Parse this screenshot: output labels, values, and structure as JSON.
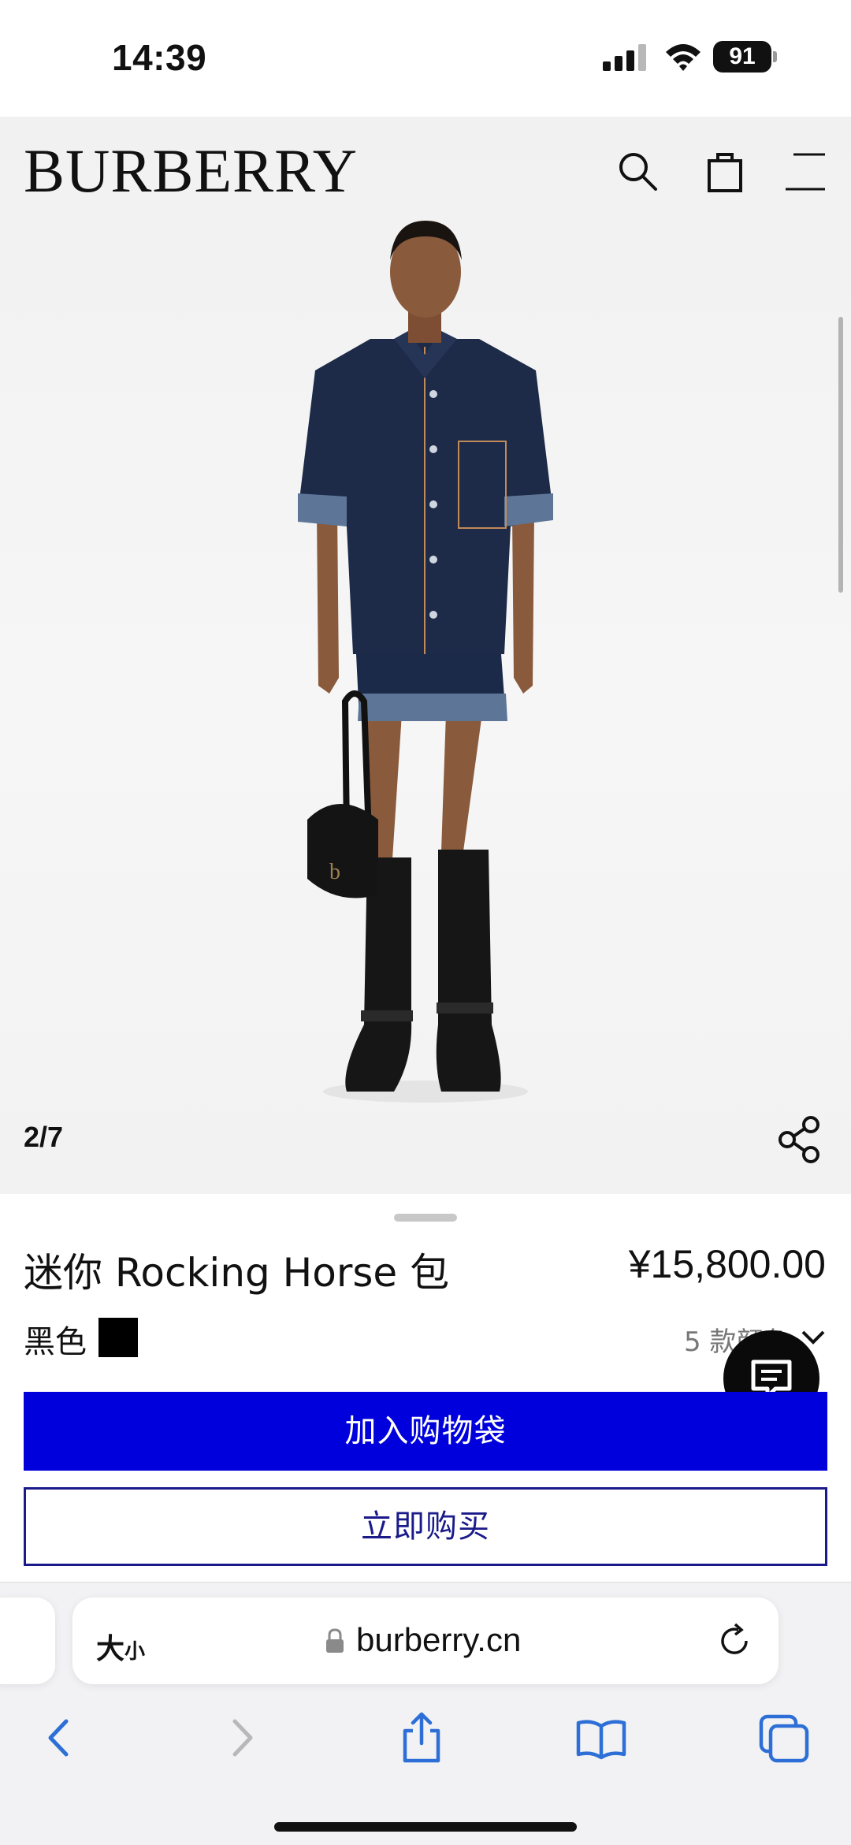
{
  "status_bar": {
    "time": "14:39",
    "battery": "91"
  },
  "header": {
    "brand": "BURBERRY"
  },
  "gallery": {
    "counter": "2/7"
  },
  "product": {
    "name": "迷你 Rocking Horse 包",
    "price": "¥15,800.00",
    "color_name": "黑色",
    "color_swatch": "#000000",
    "color_count": "5 款颜色"
  },
  "actions": {
    "add_to_bag": "加入购物袋",
    "buy_now": "立即购买"
  },
  "browser": {
    "text_size_large": "大",
    "text_size_small": "小",
    "url": "burberry.cn"
  },
  "colors": {
    "accent": "#0000dc",
    "outline": "#1a1a8a"
  },
  "icons": [
    "search-icon",
    "shopping-bag-icon",
    "menu-icon",
    "share-icon",
    "chat-icon",
    "chevron-down-icon",
    "lock-icon",
    "reload-icon",
    "back-icon",
    "forward-icon",
    "share-page-icon",
    "bookmarks-icon",
    "tabs-icon"
  ]
}
